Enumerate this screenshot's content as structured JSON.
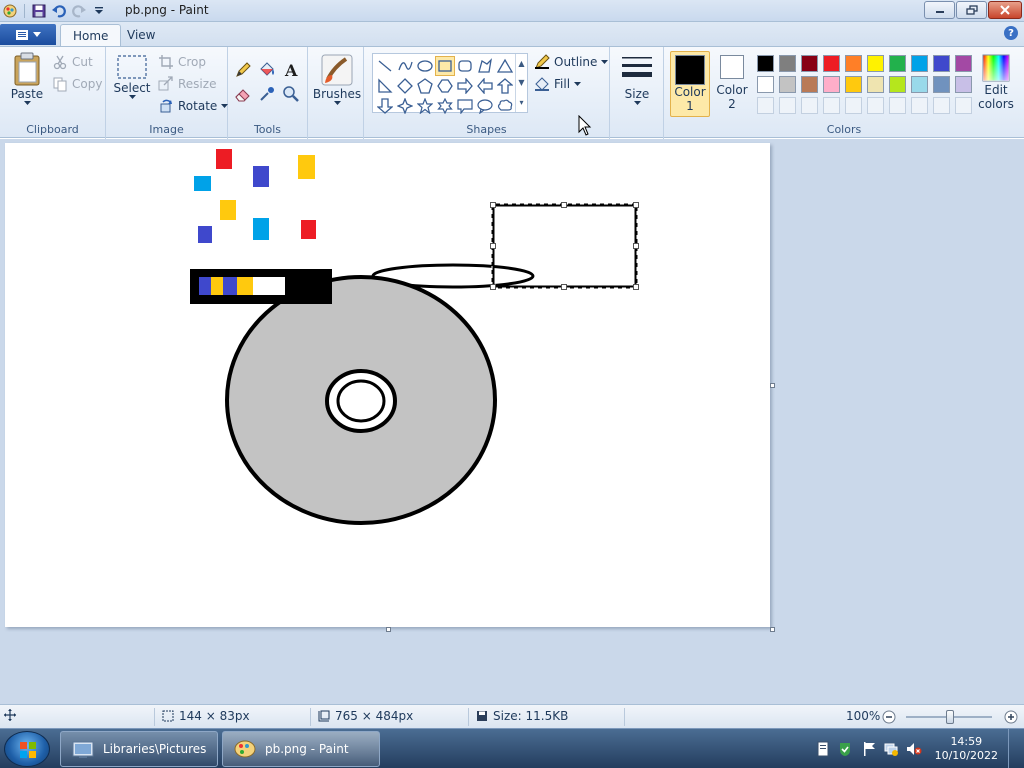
{
  "window": {
    "title": "pb.png - Paint"
  },
  "tabs": [
    {
      "label": "Home"
    },
    {
      "label": "View"
    }
  ],
  "clipboard": {
    "paste": "Paste",
    "cut": "Cut",
    "copy": "Copy",
    "label": "Clipboard"
  },
  "image": {
    "select": "Select",
    "crop": "Crop",
    "resize": "Resize",
    "rotate": "Rotate",
    "label": "Image"
  },
  "tools": {
    "label": "Tools"
  },
  "brushes": {
    "label": "Brushes"
  },
  "shapes": {
    "outline": "Outline",
    "fill": "Fill",
    "label": "Shapes"
  },
  "size": {
    "label": "Size"
  },
  "colors": {
    "color1_line1": "Color",
    "color1_line2": "1",
    "color2_line1": "Color",
    "color2_line2": "2",
    "edit_line1": "Edit",
    "edit_line2": "colors",
    "label": "Colors",
    "color1": "#000000",
    "color2": "#ffffff",
    "palette": [
      "#000000",
      "#7f7f7f",
      "#880015",
      "#ed1c24",
      "#ff7f27",
      "#fff200",
      "#22b14c",
      "#00a2e8",
      "#3f48cc",
      "#a349a4",
      "#ffffff",
      "#c3c3c3",
      "#b97a57",
      "#ffaec9",
      "#ffc90e",
      "#efe4b0",
      "#b5e61d",
      "#99d9ea",
      "#7092be",
      "#c8bfe7"
    ]
  },
  "status": {
    "selection_size": "144 × 83px",
    "canvas_size": "765 × 484px",
    "file_size": "Size: 11.5KB",
    "zoom": "100%"
  },
  "taskbar": {
    "items": [
      {
        "label": "Libraries\\Pictures"
      },
      {
        "label": "pb.png - Paint"
      }
    ],
    "time": "14:59",
    "date": "10/10/2022"
  },
  "canvas_colors": {
    "red": "#ed1c24",
    "blue": "#3f48cc",
    "cyan": "#00a2e8",
    "yellow": "#ffc90e",
    "disc_gray": "#c3c3c3"
  }
}
